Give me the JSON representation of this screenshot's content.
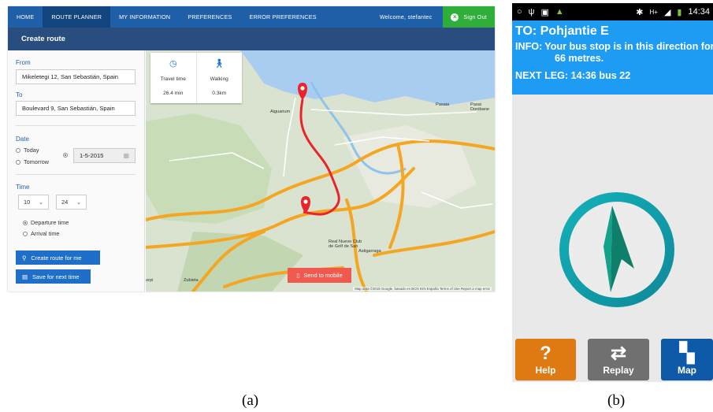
{
  "panel_a": {
    "nav": {
      "items": [
        {
          "label": "HOME"
        },
        {
          "label": "ROUTE PLANNER",
          "active": true
        },
        {
          "label": "MY INFORMATION"
        },
        {
          "label": "PREFERENCES"
        },
        {
          "label": "ERROR PREFERENCES"
        }
      ],
      "welcome": "Welcome, stefantec",
      "sign_out": "Sign Out"
    },
    "subheader": "Create route",
    "form": {
      "from_label": "From",
      "from_value": "Mikeletegi 12, San Sebastián, Spain",
      "to_label": "To",
      "to_value": "Boulevard 9, San Sebastián, Spain",
      "date_label": "Date",
      "date_today": "Today",
      "date_tomorrow": "Tomorrow",
      "date_value": "1-5-2015",
      "time_label": "Time",
      "hour": "10",
      "minute": "24",
      "departure": "Departure time",
      "arrival": "Arrival time",
      "create_btn": "Create route for me",
      "save_btn": "Save for next time"
    },
    "map": {
      "travel_time_label": "Travel time",
      "travel_time_value": "26.4 min",
      "walking_label": "Walking",
      "walking_value": "0.3km",
      "send_btn": "Send to mobile",
      "places": [
        "Pasaia",
        "Pasai Donibane",
        "Aiguarium",
        "Real Nuevo Club de Golf de San",
        "Astigarraga",
        "Zubieta",
        "orpi"
      ],
      "attribution": "Map data ©2015 Google, basado en BCN IGN España   Terms of Use   Report a map error"
    },
    "caption": "(a)"
  },
  "panel_b": {
    "status_time": "14:34",
    "to": "TO: Pohjantie E",
    "info_key": "INFO:",
    "info_line1": "Your bus stop is in this direction for",
    "info_line2": "66 metres.",
    "next_leg": "NEXT LEG: 14:36 bus 22",
    "buttons": {
      "help": "Help",
      "replay": "Replay",
      "map": "Map"
    },
    "colors": {
      "header": "#1e9cf4",
      "help": "#df7a12",
      "replay": "#707070",
      "map": "#0f5aa8",
      "ring": "#0fa7b5",
      "arrow": "#0e7f6b"
    },
    "caption": "(b)"
  }
}
